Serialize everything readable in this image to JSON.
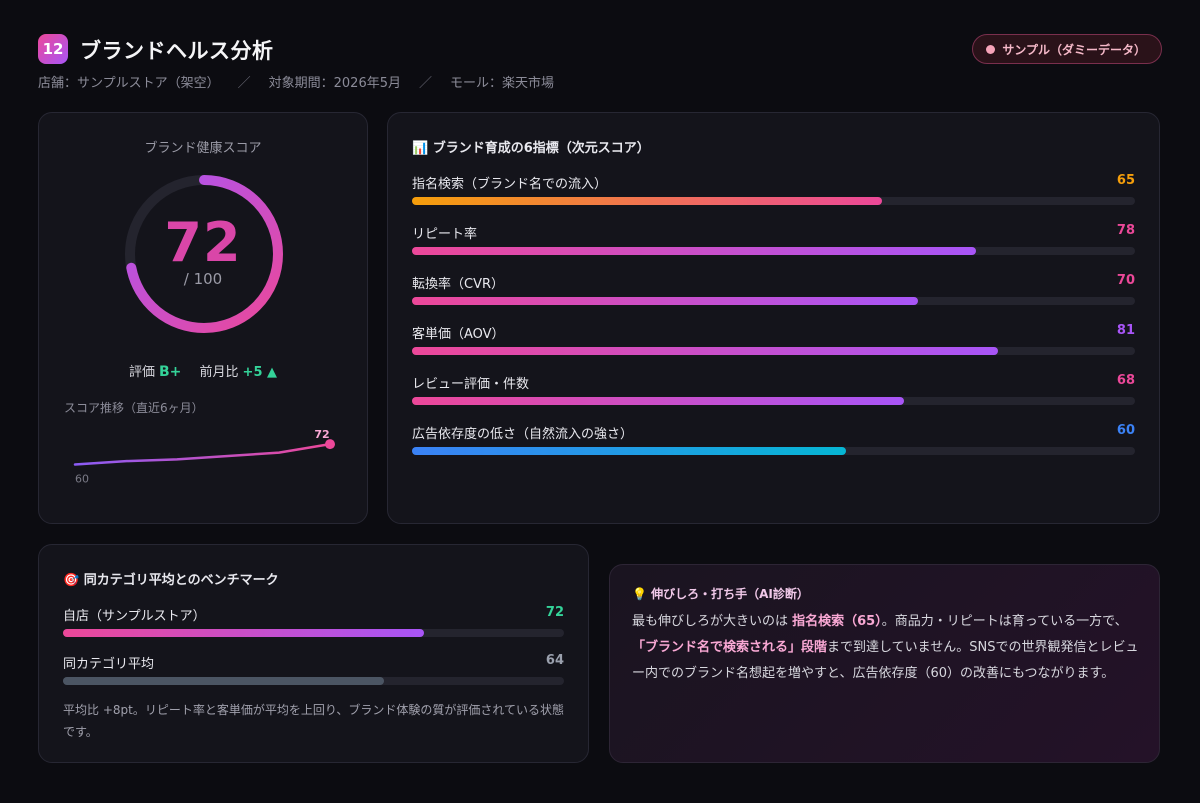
{
  "header": {
    "badge": "12",
    "title": "ブランドヘルス分析",
    "meta_store": "店舗：サンプルストア（架空）",
    "meta_period": "対象期間：2026年5月",
    "meta_mall": "モール：楽天市場",
    "separator": "／",
    "sample_label": "サンプル（ダミーデータ）"
  },
  "score_card": {
    "label": "ブランド健康スコア",
    "score": "72",
    "max": "/ 100",
    "score_fraction": 0.72,
    "rating_label": "評価",
    "grade": "B+",
    "mom_label": "前月比",
    "mom_value": "+5 ▲",
    "trend_label": "スコア推移（直近6ヶ月）",
    "trend_values": [
      60,
      62,
      63,
      65,
      67,
      72
    ],
    "trend_start_label": "60",
    "trend_end_label": "72"
  },
  "six_metrics": {
    "title": "📊 ブランド育成の6指標（次元スコア）",
    "items": [
      {
        "label": "指名検索（ブランド名での流入）",
        "value": "65",
        "score": 65,
        "color": "#f59e0b",
        "grad": [
          "#f59e0b",
          "#ec4899"
        ]
      },
      {
        "label": "リピート率",
        "value": "78",
        "score": 78,
        "color": "#ec4899",
        "grad": [
          "#ec4899",
          "#a855f7"
        ]
      },
      {
        "label": "転換率（CVR）",
        "value": "70",
        "score": 70,
        "color": "#ec4899",
        "grad": [
          "#ec4899",
          "#a855f7"
        ]
      },
      {
        "label": "客単価（AOV）",
        "value": "81",
        "score": 81,
        "color": "#a855f7",
        "grad": [
          "#ec4899",
          "#a855f7"
        ]
      },
      {
        "label": "レビュー評価・件数",
        "value": "68",
        "score": 68,
        "color": "#ec4899",
        "grad": [
          "#ec4899",
          "#a855f7"
        ]
      },
      {
        "label": "広告依存度の低さ（自然流入の強さ）",
        "value": "60",
        "score": 60,
        "color": "#3b82f6",
        "grad": [
          "#3b82f6",
          "#06b6d4"
        ]
      }
    ]
  },
  "benchmark": {
    "title": "🎯 同カテゴリ平均とのベンチマーク",
    "rows": [
      {
        "label": "自店（サンプルストア）",
        "value": "72",
        "score": 72,
        "color": "#34d399",
        "grad": [
          "#ec4899",
          "#a855f7"
        ]
      },
      {
        "label": "同カテゴリ平均",
        "value": "64",
        "score": 64,
        "color": "#9aa0ad",
        "grad": [
          "#4b5563",
          "#4b5563"
        ]
      }
    ],
    "note": "平均比 +8pt。リピート率と客単価が平均を上回り、ブランド体験の質が評価されている状態です。"
  },
  "ai": {
    "title": "💡 伸びしろ・打ち手（AI診断）",
    "p1": "最も伸びしろが大きいのは ",
    "h1": "指名検索（65）",
    "p2": "。商品力・リピートは育っている一方で、",
    "h2": "「ブランド名で検索される」段階",
    "p3": "まで到達していません。SNSでの世界観発信とレビュー内でのブランド名想起を増やすと、広告依存度（60）の改善にもつながります。"
  },
  "colors": {
    "accent_pink": "#ec4899",
    "accent_purple": "#a855f7",
    "positive": "#34d399"
  }
}
